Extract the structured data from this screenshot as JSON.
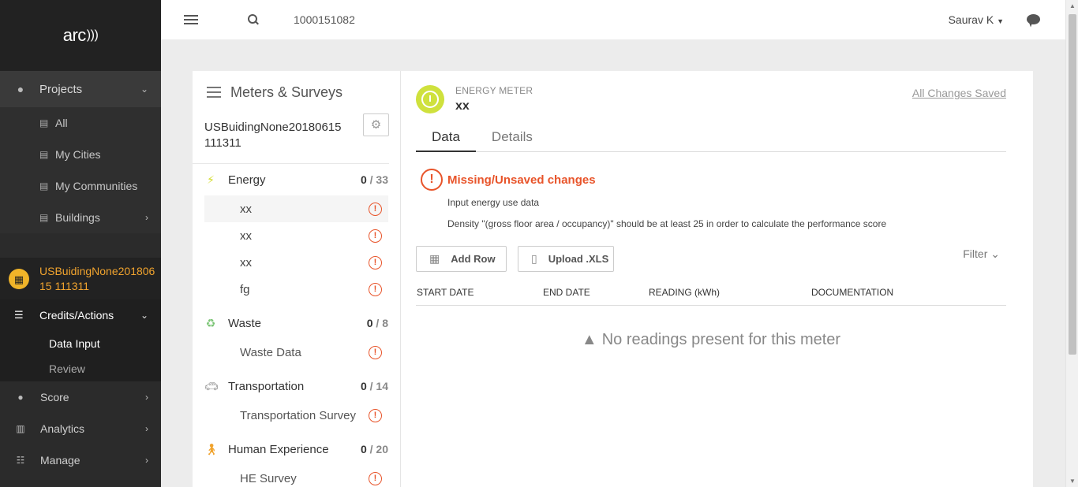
{
  "app": {
    "logo_text": "arc"
  },
  "sidebar": {
    "projects_label": "Projects",
    "project_items": [
      {
        "label": "All"
      },
      {
        "label": "My Cities"
      },
      {
        "label": "My Communities"
      },
      {
        "label": "Buildings"
      }
    ],
    "current_project": "USBuidingNone20180615 111311",
    "credits_label": "Credits/Actions",
    "data_input_label": "Data Input",
    "review_label": "Review",
    "score_label": "Score",
    "analytics_label": "Analytics",
    "manage_label": "Manage"
  },
  "topbar": {
    "search_value": "1000151082",
    "user_name": "Saurav K"
  },
  "left_panel": {
    "title": "Meters & Surveys",
    "building_name_line1": "USBuidingNone20180615",
    "building_name_line2": "111311",
    "categories": [
      {
        "name": "Energy",
        "count": "0",
        "total": "/ 33",
        "color": "#d4dc2b",
        "items": [
          "xx",
          "xx",
          "xx",
          "fg"
        ]
      },
      {
        "name": "Waste",
        "count": "0",
        "total": "/ 8",
        "color": "#7cc576",
        "items": [
          "Waste Data"
        ]
      },
      {
        "name": "Transportation",
        "count": "0",
        "total": "/ 14",
        "color": "#888888",
        "items": [
          "Transportation Survey"
        ]
      },
      {
        "name": "Human Experience",
        "count": "0",
        "total": "/ 20",
        "color": "#f0a32e",
        "items": [
          "HE Survey"
        ]
      }
    ]
  },
  "meter": {
    "type": "ENERGY METER",
    "name": "xx",
    "save_status": "All Changes Saved",
    "tabs": [
      "Data",
      "Details"
    ],
    "alert_title": "Missing/Unsaved changes",
    "messages": [
      "Input energy use data",
      "Density \"(gross floor area / occupancy)\" should be at least 25 in order to calculate the performance score"
    ],
    "add_row_label": "Add Row",
    "upload_label": "Upload .XLS",
    "filter_label": "Filter",
    "columns": [
      "START DATE",
      "END DATE",
      "READING (kWh)",
      "DOCUMENTATION"
    ],
    "empty_message": "No readings present for this meter"
  },
  "colors": {
    "accent_orange": "#e8542a",
    "project_yellow": "#f0a32e",
    "meter_green": "#cfe13d"
  }
}
